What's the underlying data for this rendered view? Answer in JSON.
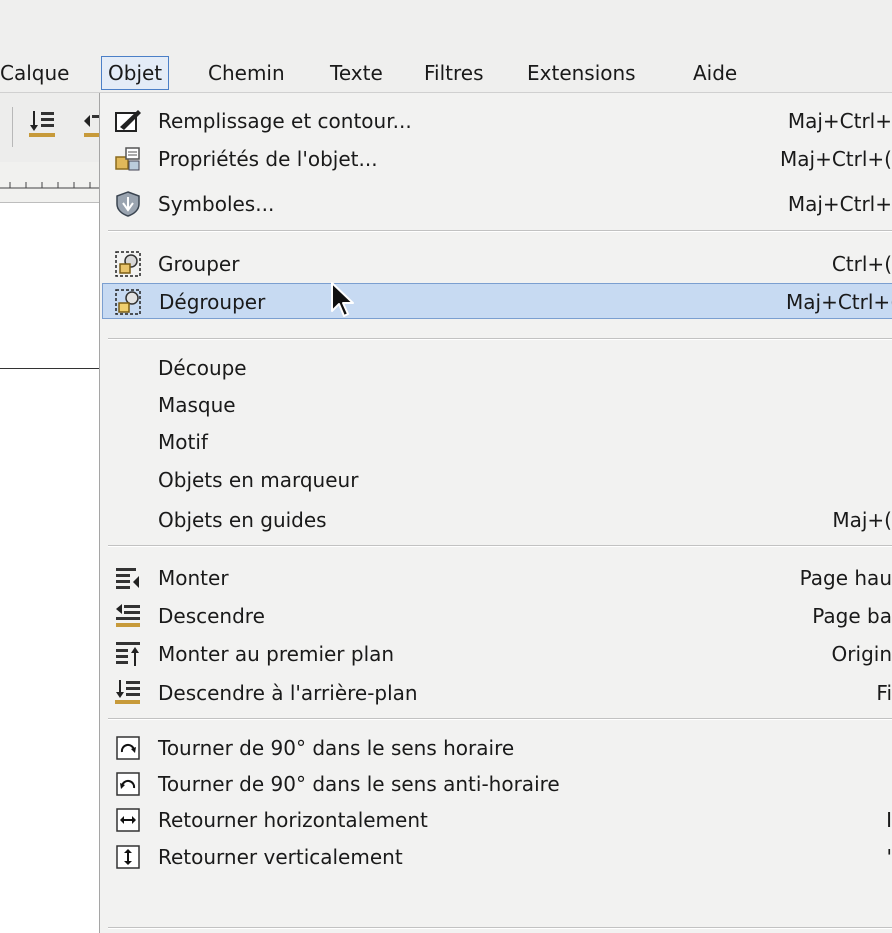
{
  "menubar": {
    "items": [
      "Calque",
      "Objet",
      "Chemin",
      "Texte",
      "Filtres",
      "Extensions",
      "Aide"
    ],
    "active_index": 1
  },
  "menu": {
    "items": [
      {
        "label": "Remplissage et contour...",
        "shortcut": "Maj+Ctrl+",
        "icon": "fill-stroke-icon"
      },
      {
        "label": "Propriétés de l'objet...",
        "shortcut": "Maj+Ctrl+(",
        "icon": "object-properties-icon"
      },
      {
        "label": "Symboles...",
        "shortcut": "Maj+Ctrl+",
        "icon": "symbols-icon"
      },
      {
        "label": "Grouper",
        "shortcut": "Ctrl+(",
        "icon": "group-icon"
      },
      {
        "label": "Dégrouper",
        "shortcut": "Maj+Ctrl+(",
        "icon": "ungroup-icon",
        "selected": true
      },
      {
        "label": "Découpe",
        "shortcut": "",
        "icon": ""
      },
      {
        "label": "Masque",
        "shortcut": "",
        "icon": ""
      },
      {
        "label": "Motif",
        "shortcut": "",
        "icon": ""
      },
      {
        "label": "Objets en marqueur",
        "shortcut": "",
        "icon": ""
      },
      {
        "label": "Objets en guides",
        "shortcut": "Maj+(",
        "icon": ""
      },
      {
        "label": "Monter",
        "shortcut": "Page hau",
        "icon": "raise-icon"
      },
      {
        "label": "Descendre",
        "shortcut": "Page ba",
        "icon": "lower-icon"
      },
      {
        "label": "Monter au premier plan",
        "shortcut": "Origin",
        "icon": "raise-to-top-icon"
      },
      {
        "label": "Descendre à l'arrière-plan",
        "shortcut": "Fi",
        "icon": "lower-to-bottom-icon"
      },
      {
        "label": "Tourner de 90° dans le sens horaire",
        "shortcut": "",
        "icon": "rotate-cw-icon"
      },
      {
        "label": "Tourner de 90° dans le sens anti-horaire",
        "shortcut": "",
        "icon": "rotate-ccw-icon"
      },
      {
        "label": "Retourner horizontalement",
        "shortcut": "I",
        "icon": "flip-horizontal-icon"
      },
      {
        "label": "Retourner verticalement",
        "shortcut": "'",
        "icon": "flip-vertical-icon"
      }
    ]
  },
  "colors": {
    "menu_bg": "#f2f2f1",
    "selection_bg": "#c7daf2",
    "selection_border": "#7b9fd0",
    "active_menu_border": "#4b7fc7"
  }
}
